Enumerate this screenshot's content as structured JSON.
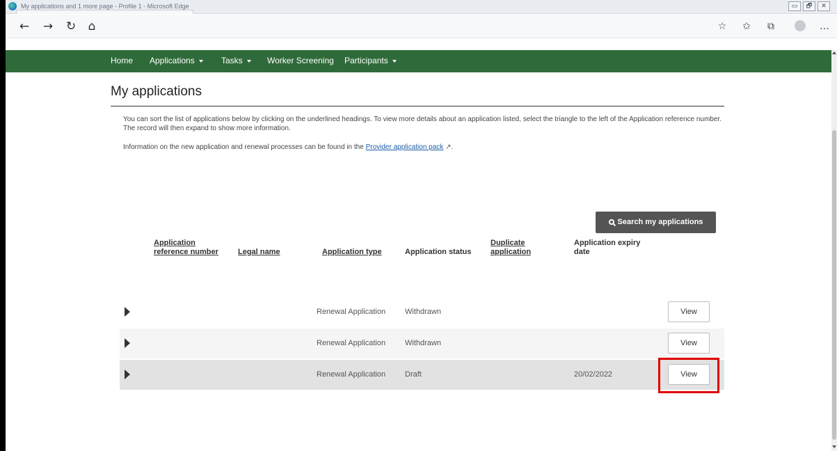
{
  "browser": {
    "window_title": "My applications and 1 more page - Profile 1 - Microsoft Edge",
    "controls": {
      "minimize": "▭",
      "restore": "🗗",
      "close": "✕"
    }
  },
  "toolbar": {
    "back": "←",
    "forward": "→",
    "refresh": "↻",
    "home": "⌂",
    "icons": [
      "favorite-icon",
      "favorites-list-icon",
      "collections-icon",
      "profile-icon",
      "more-icon"
    ],
    "favorite": "☆",
    "favorites": "✩",
    "collections": "⧉",
    "more": "…"
  },
  "nav": {
    "items": [
      {
        "label": "Home",
        "dropdown": false
      },
      {
        "label": "Applications",
        "dropdown": true
      },
      {
        "label": "Tasks",
        "dropdown": true
      },
      {
        "label": "Worker Screening",
        "dropdown": false
      },
      {
        "label": "Participants",
        "dropdown": true
      }
    ],
    "background": "#2f6b3a"
  },
  "page": {
    "title": "My applications",
    "intro": "You can sort the list of applications below by clicking on the underlined headings. To view more details about an application listed, select the triangle to the left of the Application reference number. The record will then expand to show more information.",
    "info_prefix": "Information on the new application and renewal processes can be found in the ",
    "info_link": "Provider application pack",
    "info_suffix": ".",
    "search_button": "Search my applications"
  },
  "table": {
    "headers": {
      "ref_line1": "Application",
      "ref_line2": "reference number",
      "legal_name": "Legal name",
      "type": "Application type",
      "status": "Application status",
      "duplicate_line1": "Duplicate",
      "duplicate_line2": "application",
      "expiry_line1": "Application expiry",
      "expiry_line2": "date"
    },
    "rows": [
      {
        "type": "Renewal Application",
        "status": "Withdrawn",
        "expiry": "",
        "action": "View"
      },
      {
        "type": "Renewal Application",
        "status": "Withdrawn",
        "expiry": "",
        "action": "View"
      },
      {
        "type": "Renewal Application",
        "status": "Draft",
        "expiry": "20/02/2022",
        "action": "View"
      }
    ]
  },
  "colors": {
    "nav_green": "#2f6b3a",
    "search_button": "#545454",
    "highlight": "#e00000",
    "row_alt": "#f5f5f5",
    "row_selected": "#e2e2e2"
  }
}
